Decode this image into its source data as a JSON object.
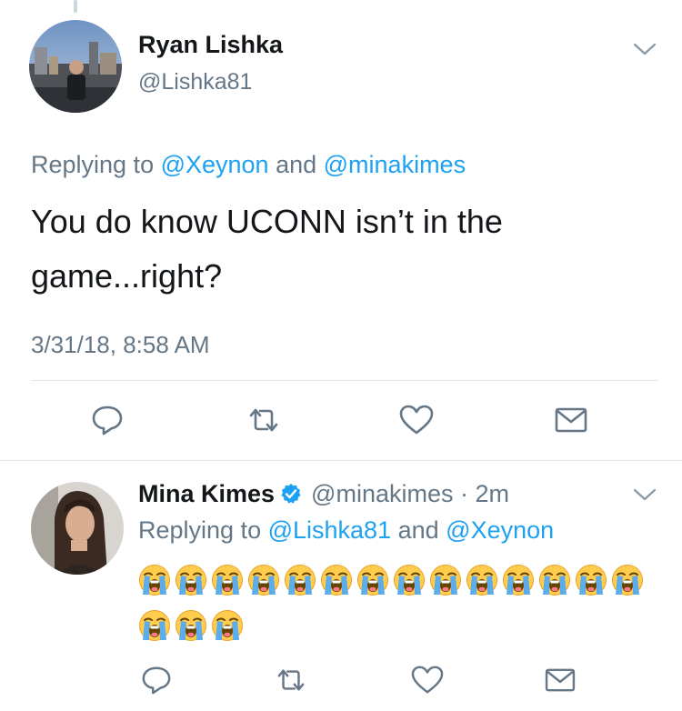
{
  "tweet": {
    "author_name": "Ryan Lishka",
    "author_handle": "@Lishka81",
    "replying_prefix": "Replying to ",
    "mention_1": "@Xeynon",
    "joiner": " and ",
    "mention_2": "@minakimes",
    "text_line_1": "You do know UCONN isn’t in the",
    "text_line_2": "game...right?",
    "timestamp": "3/31/18, 8:58 AM",
    "actions": [
      "reply-icon",
      "retweet-icon",
      "heart-icon",
      "mail-icon"
    ]
  },
  "reply_tweet": {
    "author_name": "Mina Kimes",
    "verified_icon": "verified-badge-icon",
    "author_handle": "@minakimes",
    "time_sep": " · ",
    "time": "2m",
    "replying_prefix": "Replying to ",
    "mention_1": "@Lishka81",
    "joiner": " and ",
    "mention_2": "@Xeynon",
    "emoji_name": "loudly-crying-face-emoji",
    "emoji_row_1_count": 14,
    "emoji_row_2_count": 3,
    "actions": [
      "reply-icon",
      "retweet-icon",
      "heart-icon",
      "mail-icon"
    ]
  },
  "colors": {
    "link": "#1da1f2",
    "secondary_text": "#657786",
    "icon": "#657786",
    "divider": "#e1e8ed",
    "verified": "#1da1f2"
  }
}
